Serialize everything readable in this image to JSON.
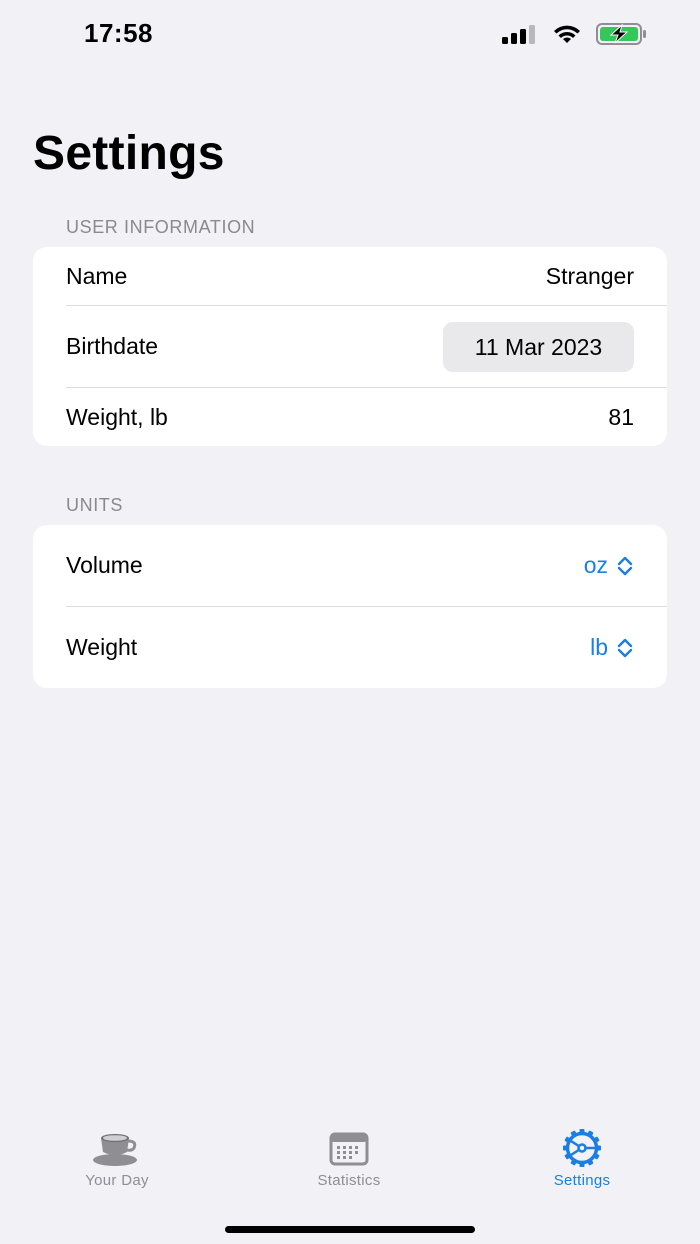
{
  "status_bar": {
    "time": "17:58"
  },
  "page": {
    "title": "Settings"
  },
  "user_information": {
    "header": "USER INFORMATION",
    "name_label": "Name",
    "name_value": "Stranger",
    "birthdate_label": "Birthdate",
    "birthdate_value": "11 Mar 2023",
    "weight_label": "Weight, lb",
    "weight_value": "81"
  },
  "units": {
    "header": "UNITS",
    "volume_label": "Volume",
    "volume_value": "oz",
    "weight_label": "Weight",
    "weight_value": "lb"
  },
  "tab_bar": {
    "tabs": [
      {
        "label": "Your Day",
        "icon": "cup-icon",
        "active": false
      },
      {
        "label": "Statistics",
        "icon": "calendar-icon",
        "active": false
      },
      {
        "label": "Settings",
        "icon": "gear-icon",
        "active": true
      }
    ]
  },
  "colors": {
    "accent": "#1a7fe0",
    "background": "#f2f1f6",
    "inactive": "#8e8e93",
    "battery_fill": "#34c759"
  }
}
